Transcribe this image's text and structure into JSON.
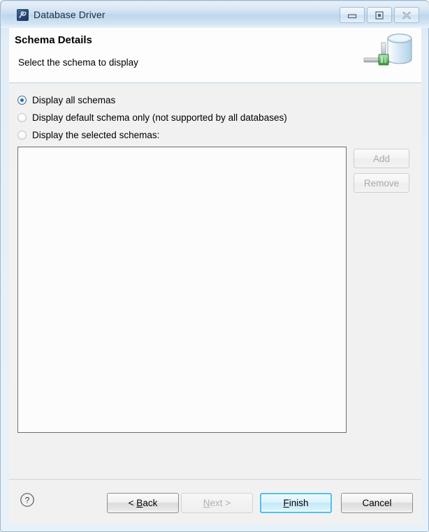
{
  "window": {
    "title": "Database Driver",
    "icon": "database-driver-icon",
    "controls": [
      {
        "name": "minimize",
        "glyph": "minimize-icon"
      },
      {
        "name": "maximize",
        "glyph": "maximize-icon"
      },
      {
        "name": "close",
        "glyph": "close-icon"
      }
    ]
  },
  "header": {
    "title": "Schema Details",
    "description": "Select the schema to display",
    "icon": "database-cylinder-icon"
  },
  "content": {
    "radio_group": {
      "name": "schema-display-mode",
      "options": [
        {
          "label": "Display all schemas",
          "selected": true,
          "enabled": true
        },
        {
          "label": "Display default schema only (not supported by all databases)",
          "selected": false,
          "enabled": true
        },
        {
          "label": "Display the selected schemas:",
          "selected": false,
          "enabled": true
        }
      ]
    },
    "schema_list": {
      "items": [],
      "empty": true
    },
    "side_buttons": [
      {
        "label": "Add",
        "enabled": false
      },
      {
        "label": "Remove",
        "enabled": false
      }
    ]
  },
  "footer": {
    "help": {
      "label": "?",
      "tooltip": "Help"
    },
    "buttons": [
      {
        "id": "back",
        "label": "< Back",
        "mnemonic": "B",
        "enabled": true,
        "default": false
      },
      {
        "id": "next",
        "label": "Next >",
        "mnemonic": "N",
        "enabled": false,
        "default": false
      },
      {
        "id": "finish",
        "label": "Finish",
        "mnemonic": "F",
        "enabled": true,
        "default": true
      },
      {
        "id": "cancel",
        "label": "Cancel",
        "mnemonic": "",
        "enabled": true,
        "default": false
      }
    ]
  },
  "colors": {
    "titlebar_blue": "#bcd6ec",
    "frame_blue": "#dce9f4",
    "content_gray": "#f1f1f1",
    "default_button_focus": "#4fc2e8",
    "radio_selected_dot": "#2a6ea8",
    "listbox_border": "#6e6e6e",
    "disabled_text": "#aaaaaa"
  }
}
